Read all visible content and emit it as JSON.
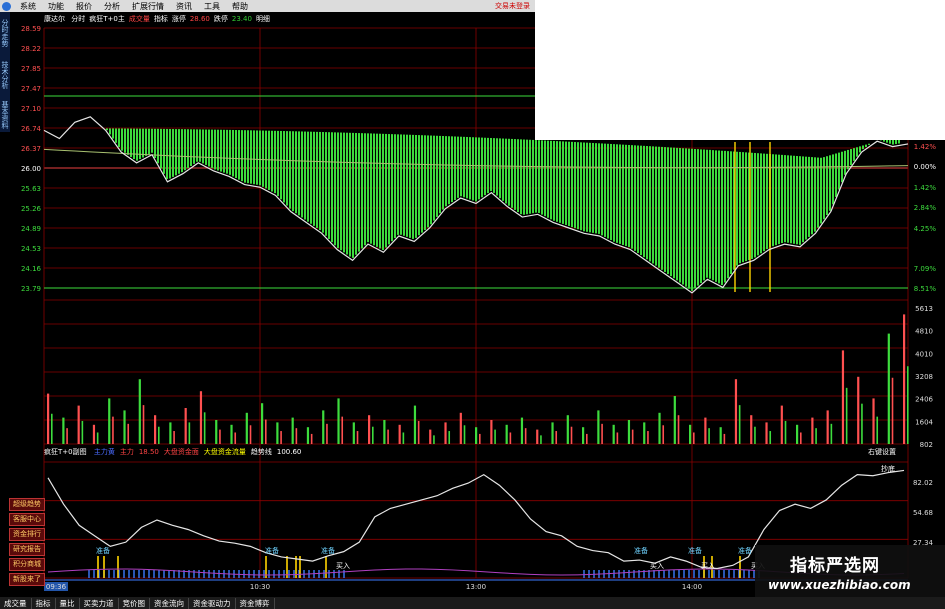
{
  "menu": {
    "items": [
      "系统",
      "功能",
      "报价",
      "分析",
      "扩展行情",
      "资讯",
      "工具",
      "帮助"
    ],
    "right_title": "交易未登录"
  },
  "side_vertical_tabs": [
    "分时走势",
    "技术分析",
    "基本资料"
  ],
  "chart_header": {
    "title": "康达尔",
    "items": [
      {
        "text": "分时",
        "color": "#ffffff"
      },
      {
        "text": "疯狂T+0主",
        "color": "#ffffff"
      },
      {
        "text": "成交量",
        "color": "#ff4444"
      },
      {
        "text": "指标",
        "color": "#ffffff"
      },
      {
        "text": "涨停",
        "color": "#ffffff"
      },
      {
        "text": "28.60",
        "color": "#ff4444"
      },
      {
        "text": "跌停",
        "color": "#ffffff"
      },
      {
        "text": "23.40",
        "color": "#33cc33"
      },
      {
        "text": "明细",
        "color": "#ffffff"
      }
    ]
  },
  "price_axis": {
    "left_labels": [
      "28.59",
      "28.22",
      "27.85",
      "27.47",
      "27.10",
      "26.74",
      "26.37",
      "26.00",
      "25.63",
      "25.26",
      "24.89",
      "24.53",
      "24.16",
      "23.79"
    ],
    "right_labels": [
      "1.42%",
      "0.00%",
      "1.42%",
      "2.84%",
      "4.25%",
      "7.09%",
      "8.51%"
    ]
  },
  "volume_axis": {
    "right_labels": [
      "5613",
      "4810",
      "4010",
      "3208",
      "2406",
      "1604",
      "802"
    ]
  },
  "indicator": {
    "name": "疯狂T+0副图",
    "items": [
      {
        "text": "主力黄",
        "color": "#4a6bff"
      },
      {
        "text": "主力",
        "color": "#ff4444"
      },
      {
        "text": "18.50",
        "color": "#ff4444"
      },
      {
        "text": "大盘资金面",
        "color": "#ff4444"
      },
      {
        "text": "大盘资金流量",
        "color": "#ffff00"
      },
      {
        "text": "趋势线",
        "color": "#ffffff"
      },
      {
        "text": "100.60",
        "color": "#ffffff"
      }
    ],
    "settings": "右键设置",
    "right_labels": [
      "82.02",
      "54.68",
      "27.34"
    ],
    "peak_label": "抄底",
    "markers": [
      "准备",
      "准备",
      "准备",
      "准备",
      "准备",
      "准备"
    ],
    "buy_labels": [
      "买入",
      "买入",
      "买入",
      "买入"
    ]
  },
  "time_axis": {
    "labels": [
      "09:36",
      "10:30",
      "13:00",
      "14:00"
    ]
  },
  "side_buttons": [
    "超级趋势",
    "客服中心",
    "资金排行",
    "研究报告",
    "积分商城",
    "新股来了"
  ],
  "bottom_tabs": [
    "成交量",
    "指标",
    "量比",
    "买卖力道",
    "竞价图",
    "资金流向",
    "资金驱动力",
    "资金博弈"
  ],
  "watermark": {
    "title": "指标严选网",
    "url": "www.xuezhibiao.com"
  },
  "colors": {
    "green": "#3ddc3d",
    "grid": "#8b0000",
    "price_line": "#e6e6e6",
    "yellow": "#ffd400",
    "blue_ticks": "#3d7bff",
    "purple": "#b040c0"
  },
  "chart_data": {
    "type": "line",
    "price_series": [
      26.7,
      26.55,
      26.85,
      26.95,
      26.7,
      26.3,
      26.1,
      26.25,
      25.75,
      25.9,
      26.1,
      25.95,
      25.85,
      25.7,
      25.65,
      25.5,
      25.2,
      25.0,
      24.8,
      24.5,
      24.3,
      24.6,
      24.45,
      24.75,
      24.65,
      24.9,
      25.25,
      25.45,
      25.35,
      25.55,
      25.3,
      25.1,
      25.15,
      25.0,
      24.9,
      24.8,
      24.75,
      24.6,
      24.5,
      24.3,
      24.1,
      23.9,
      23.7,
      23.95,
      23.8,
      24.2,
      24.3,
      24.5,
      24.6,
      24.55,
      24.8,
      25.2,
      25.9,
      26.3,
      26.5,
      26.4,
      26.45
    ],
    "volume": [
      2.1,
      1.1,
      1.6,
      0.8,
      1.9,
      1.4,
      2.7,
      1.2,
      0.9,
      1.5,
      2.2,
      1.0,
      0.8,
      1.3,
      1.7,
      0.9,
      1.1,
      0.7,
      1.4,
      1.9,
      0.9,
      1.2,
      1.0,
      0.8,
      1.6,
      0.6,
      0.9,
      1.3,
      0.7,
      1.0,
      0.8,
      1.1,
      0.6,
      0.9,
      1.2,
      0.7,
      1.4,
      0.8,
      1.0,
      0.9,
      1.3,
      2.0,
      0.8,
      1.1,
      0.7,
      2.7,
      1.2,
      0.9,
      1.6,
      0.8,
      1.1,
      1.4,
      3.9,
      2.8,
      1.9,
      4.6,
      5.4
    ],
    "indicator_line": [
      95,
      70,
      50,
      40,
      30,
      34,
      48,
      55,
      50,
      46,
      40,
      35,
      33,
      30,
      24,
      20,
      18,
      16,
      21,
      25,
      34,
      58,
      66,
      70,
      74,
      78,
      85,
      90,
      98,
      88,
      74,
      56,
      44,
      40,
      30,
      26,
      24,
      16,
      17,
      14,
      20,
      16,
      10,
      9,
      12,
      20,
      46,
      64,
      70,
      66,
      74,
      88,
      98,
      97,
      100,
      102
    ]
  }
}
